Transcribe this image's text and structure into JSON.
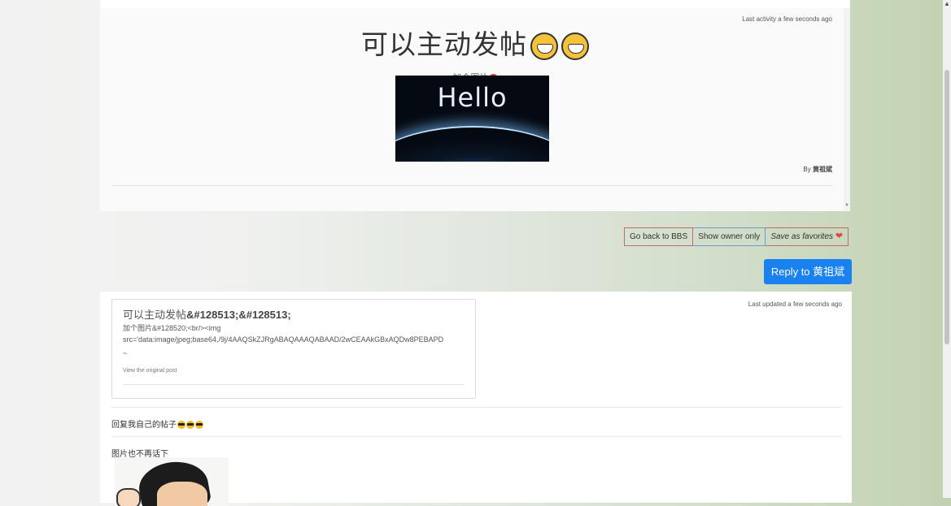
{
  "post": {
    "last_activity": "Last activity a few seconds ago",
    "title": "可以主动发帖",
    "subtitle": "加个图片",
    "image_text": "Hello",
    "by_label": "By",
    "author": "黄祖斌"
  },
  "actions": {
    "back": "Go back to BBS",
    "owner_only": "Show owner only",
    "favorites": "Save as favorites"
  },
  "reply_button": "Reply to 黄祖斌",
  "reply": {
    "last_updated": "Last updated a few seconds ago",
    "quote_title_plain": "可以主动发帖",
    "quote_title_entities": "&#128513;&#128513;",
    "quote_line1": "加个图片&#128520;<br/><img",
    "quote_line2": "src='data:image/jpeg;base64,/9j/4AAQSkZJRgABAQAAAQABAAD/2wCEAAkGBxAQDw8PEBAPD",
    "quote_line3": "~",
    "view_original": "View the original post",
    "text1": "回复我自己的帖子",
    "text2": "图片也不再话下"
  },
  "icons": [
    "grin-icon",
    "devil-icon",
    "heart-icon",
    "sunglasses-icon"
  ],
  "colors": {
    "reply_button": "#1a82f0",
    "danger_border": "#c76868",
    "info_border": "#6b9bd6"
  }
}
